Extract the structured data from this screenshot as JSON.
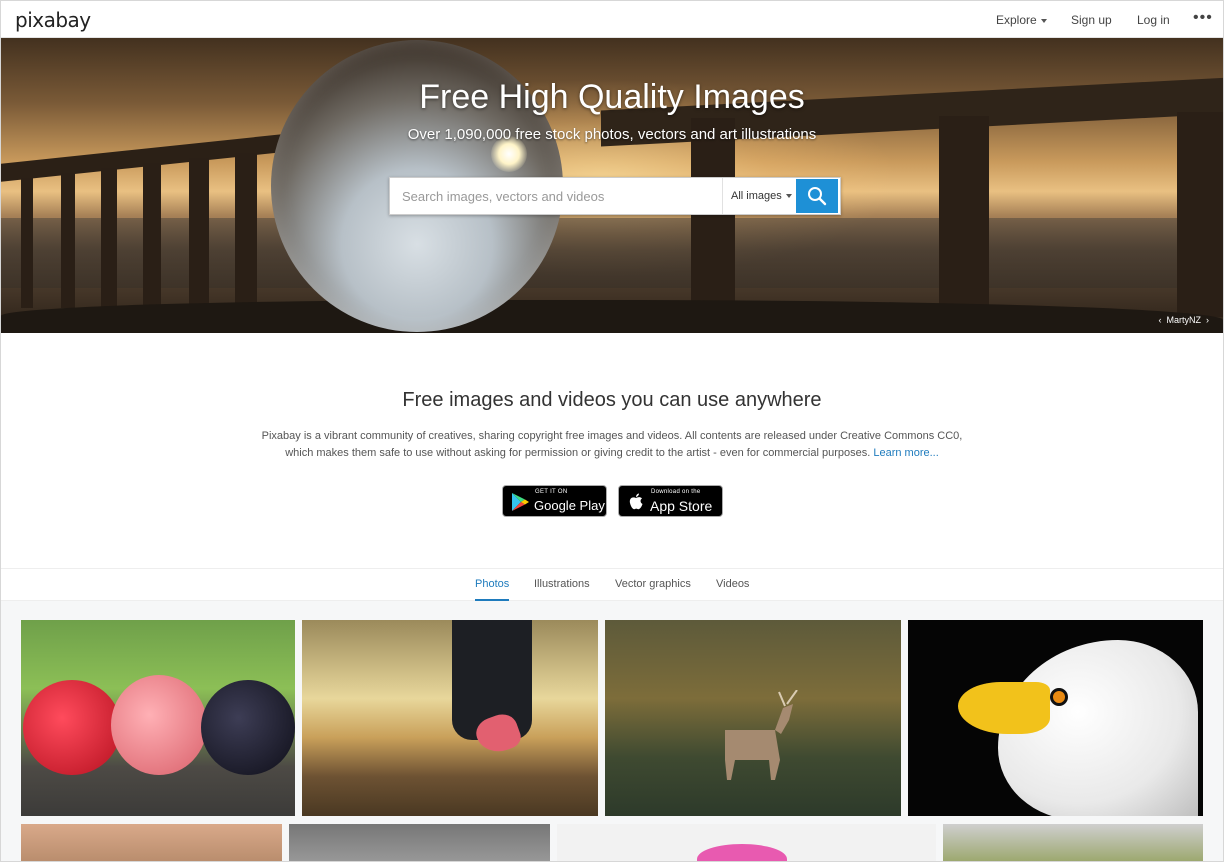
{
  "header": {
    "logo": "pixabay",
    "nav": {
      "explore": "Explore",
      "signup": "Sign up",
      "login": "Log in",
      "more": "•••"
    }
  },
  "hero": {
    "title": "Free High Quality Images",
    "subtitle": "Over 1,090,000 free stock photos, vectors and art illustrations",
    "search": {
      "placeholder": "Search images, vectors and videos",
      "value": "",
      "type_select": "All images"
    },
    "credit": "MartyNZ"
  },
  "intro": {
    "title": "Free images and videos you can use anywhere",
    "text_line1": "Pixabay is a vibrant community of creatives, sharing copyright free images and videos. All contents are released under Creative Commons CC0,",
    "text_line2": "which makes them safe to use without asking for permission or giving credit to the artist - even for commercial purposes.",
    "learn_more": "Learn more...",
    "google_play": {
      "small": "GET IT ON",
      "big": "Google Play"
    },
    "app_store": {
      "small": "Download on the",
      "big": "App Store"
    }
  },
  "tabs": [
    "Photos",
    "Illustrations",
    "Vector graphics",
    "Videos"
  ],
  "active_tab": "Photos",
  "colors": {
    "accent": "#1e90d6",
    "link": "#1e7bbd"
  }
}
